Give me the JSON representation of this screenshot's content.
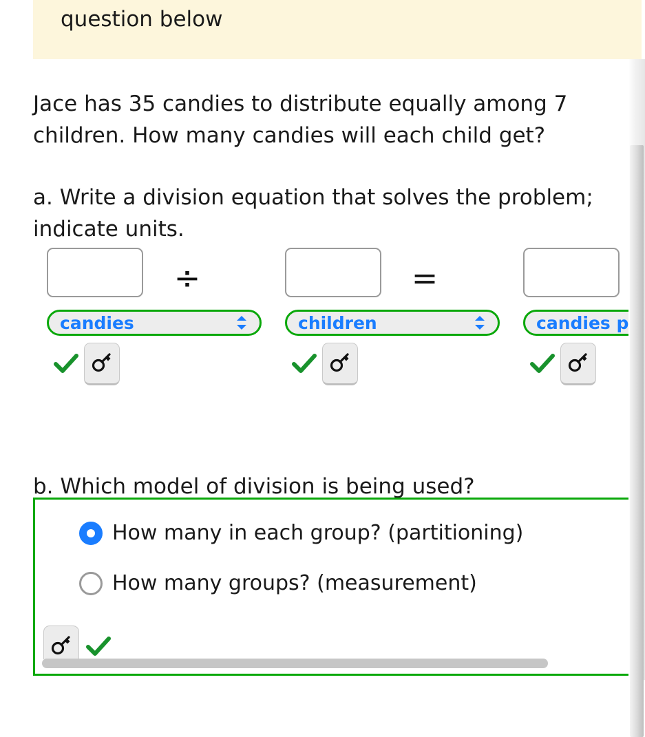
{
  "banner": {
    "text": "question below",
    "bg_color": "#fdf6dc"
  },
  "problem": {
    "prompt": "Jace has 35 candies to distribute equally among 7 children. How many candies will each child get?"
  },
  "part_a": {
    "instruction": "a. Write a division equation that solves the problem; indicate units.",
    "operators": {
      "divide": "÷",
      "equals": "="
    },
    "columns": [
      {
        "input_value": "",
        "unit_label": "candies",
        "dropdown_icon": "chevron-updown-icon",
        "feedback_icon": "check-icon",
        "key_icon": "key-icon"
      },
      {
        "input_value": "",
        "unit_label": "children",
        "dropdown_icon": "chevron-updown-icon",
        "feedback_icon": "check-icon",
        "key_icon": "key-icon"
      },
      {
        "input_value": "",
        "unit_label": "candies per",
        "dropdown_icon": "chevron-updown-icon",
        "feedback_icon": "check-icon",
        "key_icon": "key-icon"
      }
    ]
  },
  "part_b": {
    "question": "b. Which model of division is being used?",
    "choices": [
      {
        "label": "How many in each group? (partitioning)",
        "selected": true
      },
      {
        "label": "How many groups? (measurement)",
        "selected": false
      }
    ],
    "key_icon": "key-icon",
    "feedback_icon": "check-icon"
  },
  "colors": {
    "accent_blue": "#1a7dff",
    "success_green": "#0aa80a",
    "check_green": "#18922c",
    "box_border_gray": "#9a9a9a",
    "pill_bg": "#ededed"
  },
  "scrollbars": {
    "vertical_present": true,
    "horizontal_present": true
  }
}
